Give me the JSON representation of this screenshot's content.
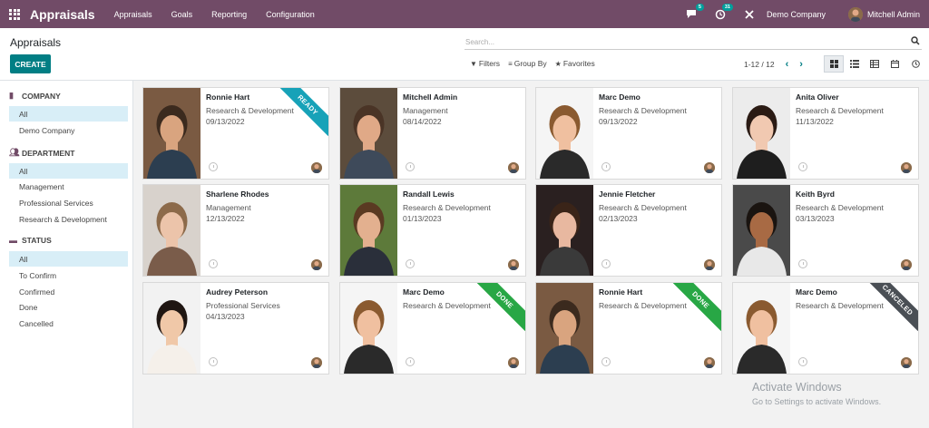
{
  "navbar": {
    "brand": "Appraisals",
    "menu": [
      "Appraisals",
      "Goals",
      "Reporting",
      "Configuration"
    ],
    "messages_count": "5",
    "activities_count": "31",
    "company": "Demo Company",
    "user": "Mitchell Admin"
  },
  "control_panel": {
    "breadcrumb": "Appraisals",
    "create_label": "CREATE",
    "search_placeholder": "Search...",
    "filters_label": "Filters",
    "groupby_label": "Group By",
    "favorites_label": "Favorites",
    "pager": "1-12 / 12"
  },
  "sidebar": {
    "sections": [
      {
        "title": "COMPANY",
        "icon": "building-icon",
        "items": [
          "All",
          "Demo Company"
        ]
      },
      {
        "title": "DEPARTMENT",
        "icon": "users-icon",
        "items": [
          "All",
          "Management",
          "Professional Services",
          "Research & Development"
        ]
      },
      {
        "title": "STATUS",
        "icon": "folder-icon",
        "items": [
          "All",
          "To Confirm",
          "Confirmed",
          "Done",
          "Cancelled"
        ]
      }
    ]
  },
  "cards": [
    {
      "name": "Ronnie Hart",
      "dept": "Research & Development",
      "date": "09/13/2022",
      "ribbon": "READY",
      "ribbon_color": "#17a2b8",
      "skin": "#d9a47f",
      "hair": "#3b2a1e",
      "shirt": "#2c3e50",
      "bg": "#7a5a42"
    },
    {
      "name": "Mitchell Admin",
      "dept": "Management",
      "date": "08/14/2022",
      "ribbon": "",
      "ribbon_color": "",
      "skin": "#e0a987",
      "hair": "#4a3426",
      "shirt": "#3e4a5a",
      "bg": "#5c4c3c"
    },
    {
      "name": "Marc Demo",
      "dept": "Research & Development",
      "date": "09/13/2022",
      "ribbon": "",
      "ribbon_color": "",
      "skin": "#f0c0a0",
      "hair": "#8a5a30",
      "shirt": "#2a2a2a",
      "bg": "#f5f5f5"
    },
    {
      "name": "Anita Oliver",
      "dept": "Research & Development",
      "date": "11/13/2022",
      "ribbon": "",
      "ribbon_color": "",
      "skin": "#f1c9b1",
      "hair": "#2b1b14",
      "shirt": "#1e1e1e",
      "bg": "#ececec"
    },
    {
      "name": "Sharlene Rhodes",
      "dept": "Management",
      "date": "12/13/2022",
      "ribbon": "",
      "ribbon_color": "",
      "skin": "#ecc4aa",
      "hair": "#8c6a4a",
      "shirt": "#7a5c4a",
      "bg": "#d8d2cc"
    },
    {
      "name": "Randall Lewis",
      "dept": "Research & Development",
      "date": "01/13/2023",
      "ribbon": "",
      "ribbon_color": "",
      "skin": "#e3b08f",
      "hair": "#5a3a22",
      "shirt": "#2a2f3a",
      "bg": "#5d7a3a"
    },
    {
      "name": "Jennie Fletcher",
      "dept": "Research & Development",
      "date": "02/13/2023",
      "ribbon": "",
      "ribbon_color": "",
      "skin": "#e8b8a0",
      "hair": "#3a2418",
      "shirt": "#3a3a3a",
      "bg": "#2a2020"
    },
    {
      "name": "Keith Byrd",
      "dept": "Research & Development",
      "date": "03/13/2023",
      "ribbon": "",
      "ribbon_color": "",
      "skin": "#a86a44",
      "hair": "#1a1410",
      "shirt": "#e8e8e8",
      "bg": "#4a4a4a"
    },
    {
      "name": "Audrey Peterson",
      "dept": "Professional Services",
      "date": "04/13/2023",
      "ribbon": "",
      "ribbon_color": "",
      "skin": "#f0c8a8",
      "hair": "#1f1612",
      "shirt": "#f5f0ea",
      "bg": "#f2f2f2"
    },
    {
      "name": "Marc Demo",
      "dept": "Research & Development",
      "date": "",
      "ribbon": "DONE",
      "ribbon_color": "#28a745",
      "skin": "#f0c0a0",
      "hair": "#8a5a30",
      "shirt": "#2a2a2a",
      "bg": "#f5f5f5"
    },
    {
      "name": "Ronnie Hart",
      "dept": "Research & Development",
      "date": "",
      "ribbon": "DONE",
      "ribbon_color": "#28a745",
      "skin": "#d9a47f",
      "hair": "#3b2a1e",
      "shirt": "#2c3e50",
      "bg": "#7a5a42"
    },
    {
      "name": "Marc Demo",
      "dept": "Research & Development",
      "date": "",
      "ribbon": "CANCELED",
      "ribbon_color": "#4a4f55",
      "skin": "#f0c0a0",
      "hair": "#8a5a30",
      "shirt": "#2a2a2a",
      "bg": "#f5f5f5"
    }
  ],
  "watermark": {
    "line1": "Activate Windows",
    "line2": "Go to Settings to activate Windows."
  }
}
